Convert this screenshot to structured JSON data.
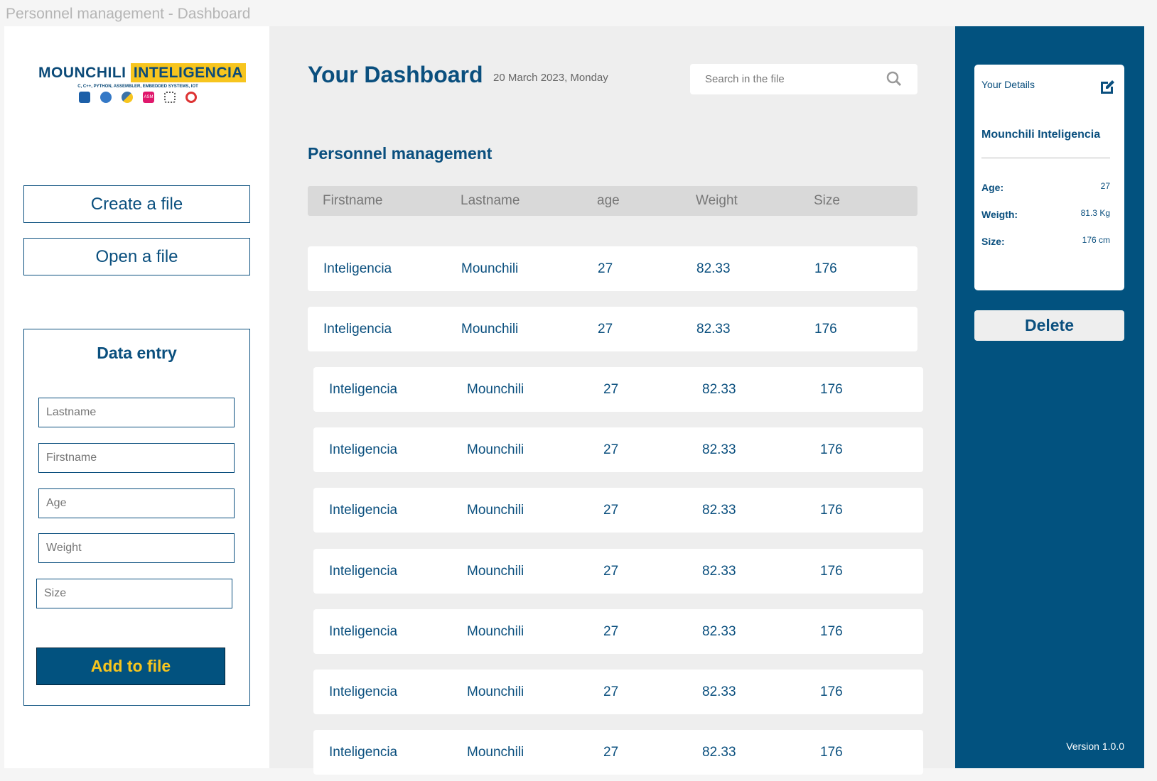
{
  "window_title": "Personnel management - Dashboard",
  "logo": {
    "part1": "MOUNCHILI",
    "part2": "INTELIGENCIA",
    "tagline": "C, C++, PYTHON, ASSEMBLER, EMBEDDED SYSTEMS, IOT",
    "asm": "ASM"
  },
  "sidebar": {
    "create": "Create a file",
    "open": "Open a file",
    "entry_title": "Data entry",
    "placeholders": {
      "lastname": "Lastname",
      "firstname": "Firstname",
      "age": "Age",
      "weight": "Weight",
      "size": "Size"
    },
    "add": "Add  to file"
  },
  "main": {
    "title": "Your Dashboard",
    "date": "20 March 2023, Monday",
    "search_placeholder": "Search in the file",
    "section": "Personnel management",
    "headers": [
      "Firstname",
      "Lastname",
      "age",
      "Weight",
      "Size"
    ],
    "rows": [
      [
        "Inteligencia",
        "Mounchili",
        "27",
        "82.33",
        "176"
      ],
      [
        "Inteligencia",
        "Mounchili",
        "27",
        "82.33",
        "176"
      ],
      [
        "Inteligencia",
        "Mounchili",
        "27",
        "82.33",
        "176"
      ],
      [
        "Inteligencia",
        "Mounchili",
        "27",
        "82.33",
        "176"
      ],
      [
        "Inteligencia",
        "Mounchili",
        "27",
        "82.33",
        "176"
      ],
      [
        "Inteligencia",
        "Mounchili",
        "27",
        "82.33",
        "176"
      ],
      [
        "Inteligencia",
        "Mounchili",
        "27",
        "82.33",
        "176"
      ],
      [
        "Inteligencia",
        "Mounchili",
        "27",
        "82.33",
        "176"
      ],
      [
        "Inteligencia",
        "Mounchili",
        "27",
        "82.33",
        "176"
      ]
    ]
  },
  "details": {
    "title": "Your Details",
    "name": "Mounchili Inteligencia",
    "age_label": "Age:",
    "age": "27",
    "weight_label": "Weigth:",
    "weight": "81.3 Kg",
    "size_label": "Size:",
    "size": "176 cm",
    "delete": "Delete",
    "version": "Version 1.0.0"
  }
}
